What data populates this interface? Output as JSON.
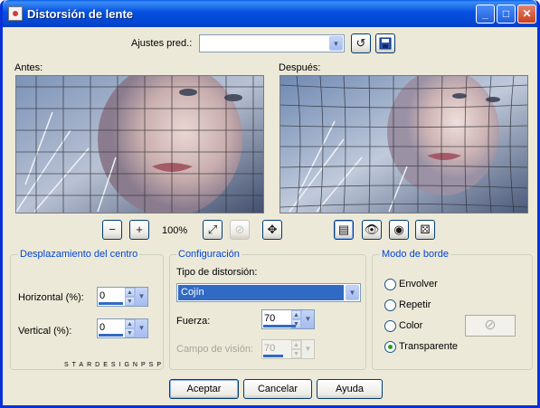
{
  "window": {
    "title": "Distorsión de lente"
  },
  "titlebar_buttons": {
    "minimize": "_",
    "maximize": "□",
    "close": "✕"
  },
  "presets": {
    "label": "Ajustes pred.:",
    "value": ""
  },
  "previews": {
    "before_label": "Antes:",
    "after_label": "Después:"
  },
  "zoom": {
    "level": "100%"
  },
  "center": {
    "title": "Desplazamiento del centro",
    "horizontal_label": "Horizontal (%):",
    "horizontal_value": "0",
    "vertical_label": "Vertical (%):",
    "vertical_value": "0",
    "watermark": "STARDESIGNPSP"
  },
  "config": {
    "title": "Configuración",
    "type_label": "Tipo de distorsión:",
    "type_value": "Cojín",
    "strength_label": "Fuerza:",
    "strength_value": "70",
    "fov_label": "Campo de visión:",
    "fov_value": "70"
  },
  "border_mode": {
    "title": "Modo de borde",
    "options": [
      "Envolver",
      "Repetir",
      "Color",
      "Transparente"
    ],
    "selected": "Transparente"
  },
  "buttons": {
    "ok": "Aceptar",
    "cancel": "Cancelar",
    "help": "Ayuda"
  },
  "colors": {
    "title_blue": "#0550e0",
    "group_label": "#0046d5",
    "dialog_bg": "#ece9d8"
  }
}
